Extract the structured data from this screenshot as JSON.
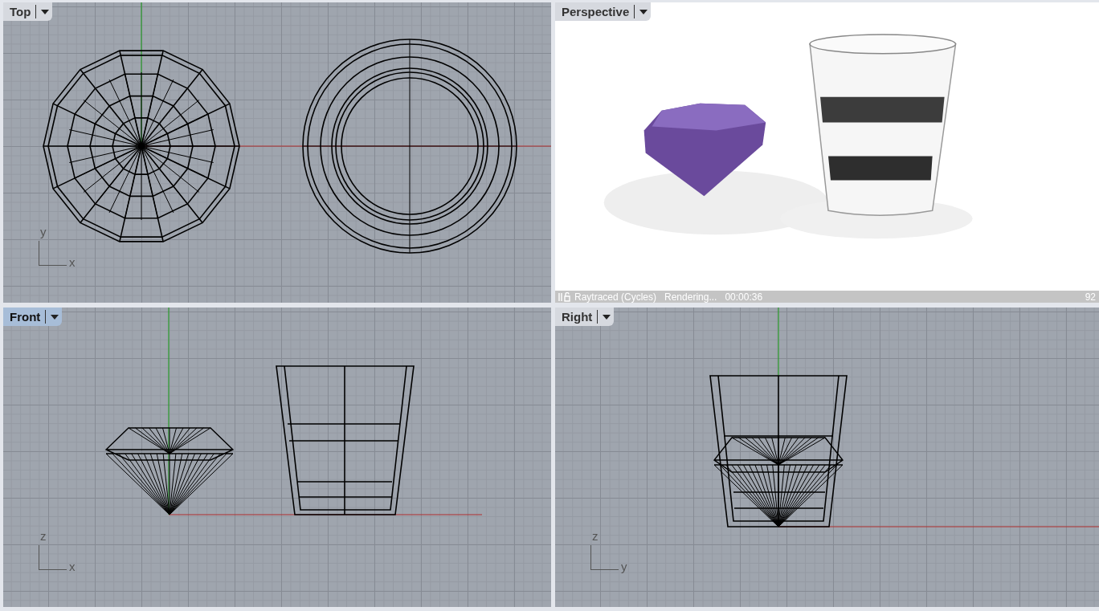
{
  "viewports": [
    {
      "label": "Top",
      "selected": false,
      "kind": "top",
      "axis_v": "y",
      "axis_h": "x"
    },
    {
      "label": "Perspective",
      "selected": false,
      "kind": "render",
      "status": {
        "mode": "Raytraced (Cycles)",
        "state": "Rendering...",
        "time": "00:00:36",
        "passes": "92"
      }
    },
    {
      "label": "Front",
      "selected": true,
      "kind": "front",
      "axis_v": "z",
      "axis_h": "x"
    },
    {
      "label": "Right",
      "selected": false,
      "kind": "right",
      "axis_v": "z",
      "axis_h": "y"
    }
  ]
}
